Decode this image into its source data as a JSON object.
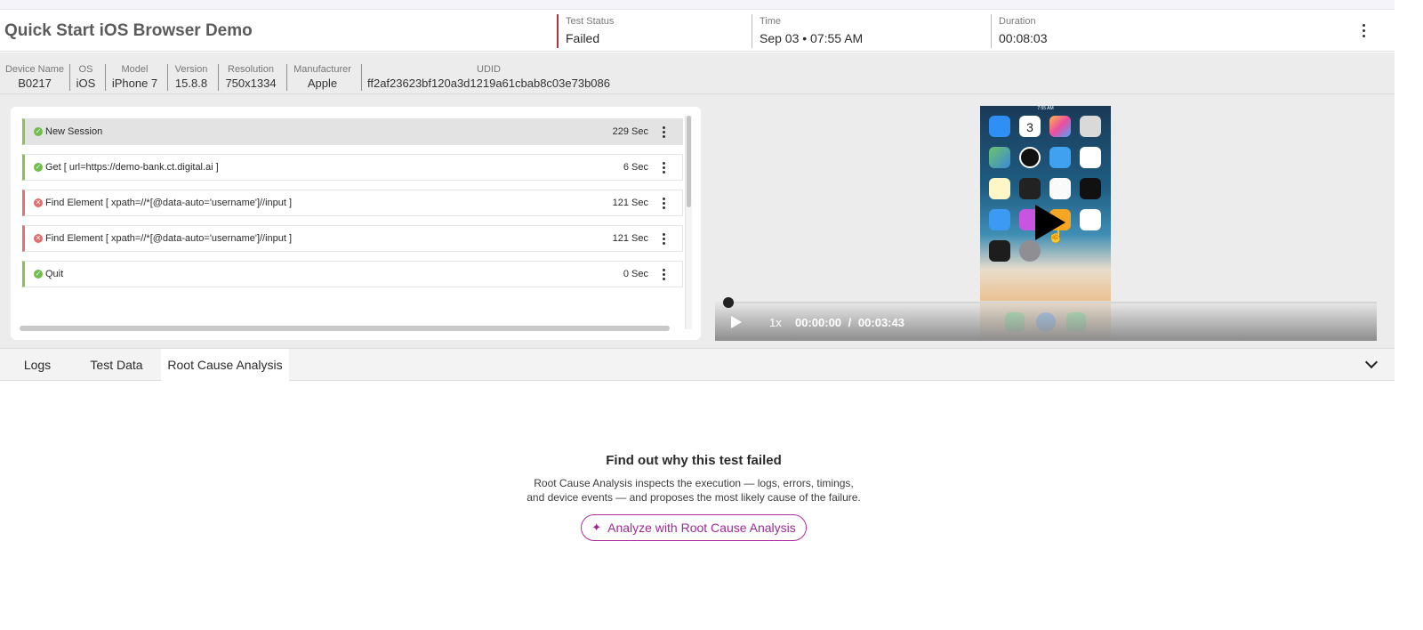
{
  "header": {
    "title": "Quick Start iOS Browser Demo",
    "stats": [
      {
        "label": "Test Status",
        "value": "Failed"
      },
      {
        "label": "Time",
        "value": "Sep 03 • 07:55 AM"
      },
      {
        "label": "Duration",
        "value": "00:08:03"
      }
    ],
    "status_color": "#b5343b"
  },
  "device": [
    {
      "label": "Device Name",
      "value": "B0217"
    },
    {
      "label": "OS",
      "value": "iOS"
    },
    {
      "label": "Model",
      "value": "iPhone 7"
    },
    {
      "label": "Version",
      "value": "15.8.8"
    },
    {
      "label": "Resolution",
      "value": "750x1334"
    },
    {
      "label": "Manufacturer",
      "value": "Apple"
    },
    {
      "label": "UDID",
      "value": "ff2af23623bf120a3d1219a61cbab8c03e73b086"
    }
  ],
  "steps": [
    {
      "name": "New Session",
      "duration": "229 Sec",
      "status": "passed",
      "selected": true
    },
    {
      "name": "Get [ url=https://demo-bank.ct.digital.ai ]",
      "duration": "6 Sec",
      "status": "passed"
    },
    {
      "name": "Find Element [ xpath=//*[@data-auto='username']//input ]",
      "duration": "121 Sec",
      "status": "failed"
    },
    {
      "name": "Find Element [ xpath=//*[@data-auto='username']//input ]",
      "duration": "121 Sec",
      "status": "failed"
    },
    {
      "name": "Quit",
      "duration": "0 Sec",
      "status": "passed"
    }
  ],
  "video": {
    "speed": "1x",
    "current_time": "00:00:00",
    "separator": "/",
    "total_time": "00:03:43",
    "progress": 0,
    "phone": {
      "status_time": "7:55 AM",
      "calendar_day": "3"
    }
  },
  "tabs": [
    {
      "label": "Logs"
    },
    {
      "label": "Test Data"
    },
    {
      "label": "Root Cause Analysis",
      "active": true
    }
  ],
  "rca": {
    "title": "Find out why this test failed",
    "desc_line1": "Root Cause Analysis inspects the execution — logs, errors, timings,",
    "desc_line2": "and device events — and proposes the most likely cause of the failure.",
    "button_label": "Analyze with Root Cause Analysis",
    "button_icon": "sparkle-icon",
    "accent": "#9a2a94"
  },
  "colors": {
    "passed": "#6fbf4a",
    "failed": "#e46b6b",
    "passed_bar": "#8bc34a",
    "failed_bar": "#ef6c6c"
  }
}
